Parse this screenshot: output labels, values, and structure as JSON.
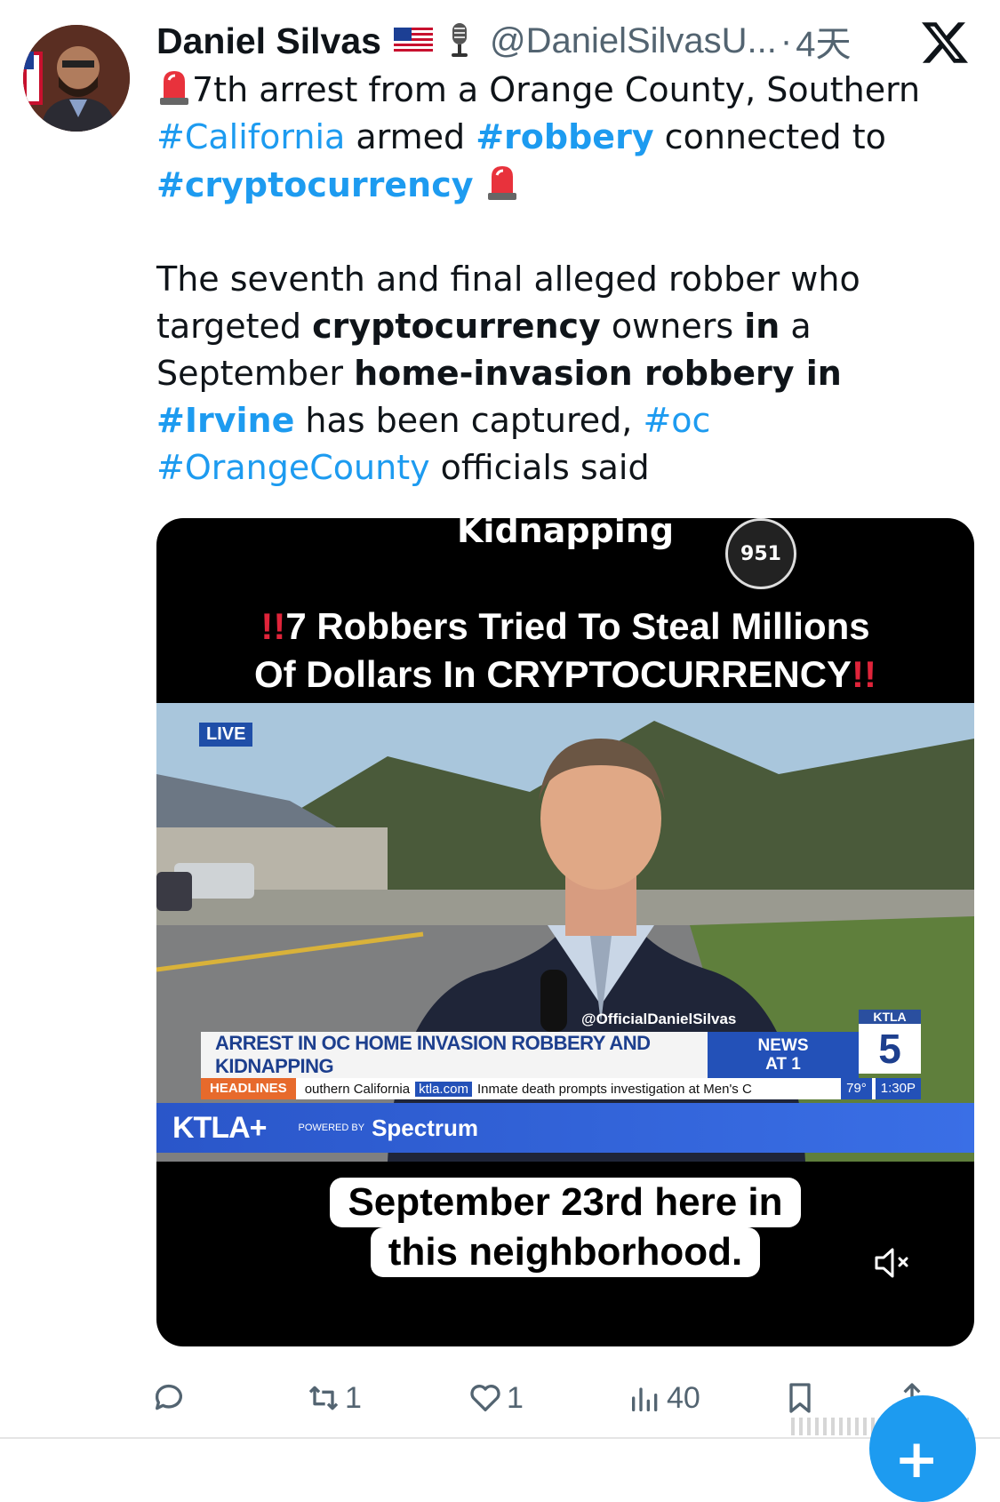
{
  "author": {
    "name": "Daniel Silvas",
    "handle": "@DanielSilvasU...",
    "separator": "·",
    "time": "4天"
  },
  "tweet": {
    "line1": {
      "pre": "7th arrest from a Orange County, Southern"
    },
    "line2": {
      "tag1": "#California",
      "mid": " armed ",
      "tag2": "#robbery",
      "post": " connected to"
    },
    "line3": {
      "tag": "#cryptocurrency"
    },
    "para2": {
      "p1": "The seventh and final alleged robber who targeted ",
      "b1": "cryptocurrency",
      "p2": " owners ",
      "b2": "in",
      "p3": " a September ",
      "b3": "home-invasion robbery in",
      "p4": " ",
      "tag1": "#Irvine",
      "p5": " has been captured, ",
      "tag2": "#oc",
      "p6": " ",
      "tag3": "#OrangeCounty",
      "p7": " officials said"
    }
  },
  "media": {
    "top_text": "Kidnapping",
    "logo_text": "951",
    "headline_marks": "!!",
    "headline_line1": "7 Robbers Tried To Steal Millions",
    "headline_line2": "Of Dollars In CRYPTOCURRENCY",
    "live_badge": "LIVE",
    "watermark": "@OfficialDanielSilvas",
    "lower_third": "ARREST IN OC HOME INVASION ROBBERY AND KIDNAPPING",
    "news_line1": "NEWS",
    "news_line2": "AT 1",
    "channel_small": "KTLA",
    "channel_num": "5",
    "ticker_label": "HEADLINES",
    "ticker_text1": "outhern California",
    "ticker_site": "ktla.com",
    "ticker_text2": "Inmate death prompts investigation at Men's C",
    "ticker_temp": "79°",
    "ticker_time": "1:30P",
    "brand": "KTLA+",
    "powered_by": "POWERED BY",
    "sponsor": "Spectrum",
    "caption_line1": "September 23rd here in",
    "caption_line2": "this neighborhood."
  },
  "actions": {
    "reply_count": "",
    "retweet_count": "1",
    "like_count": "1",
    "views_count": "40"
  },
  "colors": {
    "link": "#1d9bf0",
    "muted": "#536471"
  }
}
